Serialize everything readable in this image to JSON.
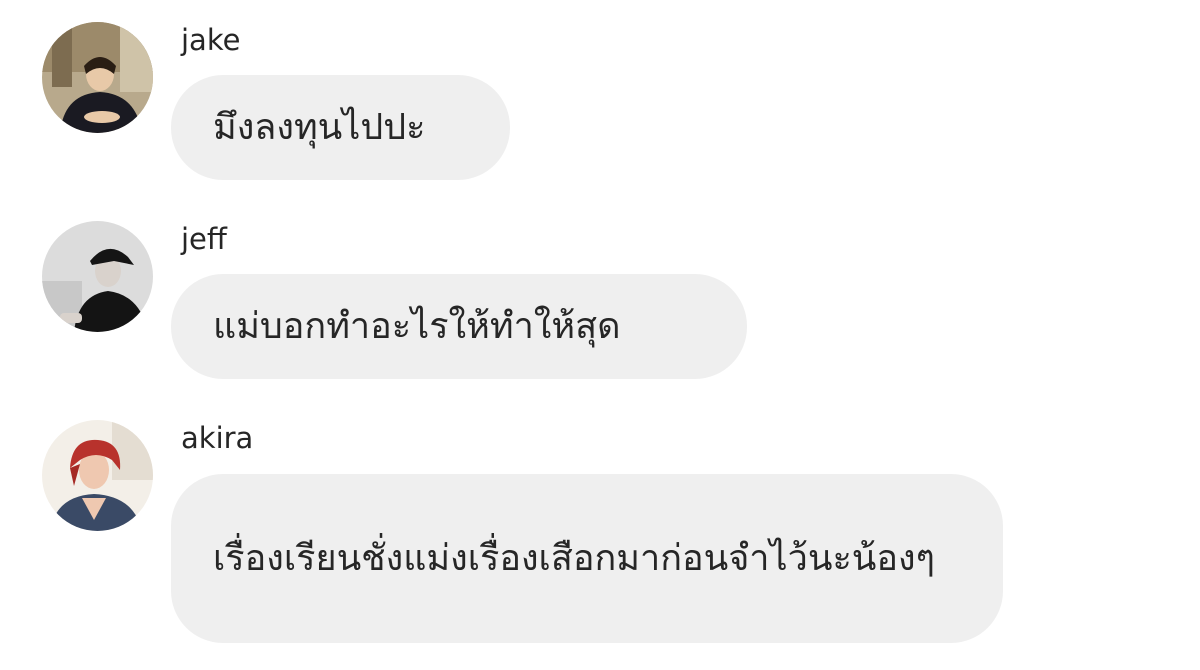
{
  "messages": [
    {
      "sender": "jake",
      "text": "มึงลงทุนไปปะ"
    },
    {
      "sender": "jeff",
      "text": "แม่บอกทำอะไรให้ทำให้สุด"
    },
    {
      "sender": "akira",
      "text": "เรื่องเรียนชั่งแม่งเรื่องเสือกมาก่อนจำไว้นะน้องๆ"
    }
  ],
  "colors": {
    "bubble": "#efefef",
    "text": "#262626",
    "background": "#ffffff"
  }
}
